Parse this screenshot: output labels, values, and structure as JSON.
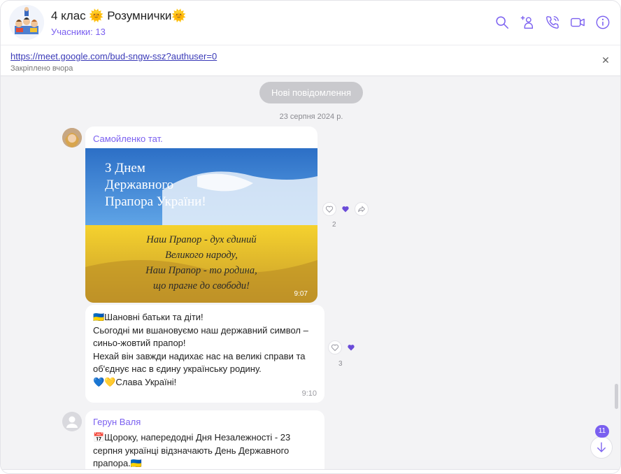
{
  "header": {
    "title": "4 клас 🌞 Розумнички🌞",
    "subtitle": "Учасники: 13",
    "icons": [
      "search-icon",
      "add-participant-icon",
      "voice-call-icon",
      "video-call-icon",
      "info-icon"
    ]
  },
  "pinned": {
    "link": "https://meet.google.com/bud-sngw-ssz?authuser=0",
    "note": "Закріплено вчора",
    "close_icon": "close-icon"
  },
  "chat": {
    "new_messages_label": "Нові повідомлення",
    "date_label": "23 серпня 2024 р.",
    "messages": [
      {
        "sender": "Самойленко тат.",
        "image_text": {
          "title_line1": "З Днем",
          "title_line2": "Державного",
          "title_line3": "Прапора України!",
          "poem_line1": "Наш Прапор - дух єдиний",
          "poem_line2": "Великого народу,",
          "poem_line3": "Наш Прапор - то родина,",
          "poem_line4": "що прагне до свободи!"
        },
        "time": "9:07",
        "reaction_count": "2"
      },
      {
        "text": "🇺🇦Шановні батьки та діти!\nСьогодні ми вшановуємо наш державний символ – синьо-жовтий прапор!\n Нехай він завжди надихає нас на великі справи та об'єднує нас в єдину українську родину.\n💙💛Слава Україні!",
        "time": "9:10",
        "reaction_count": "3"
      },
      {
        "sender": "Герун Валя",
        "text": "📅Щороку, напередодні Дня Незалежності - 23 серпня українці відзначають День Державного прапора.🇺🇦"
      }
    ],
    "unread_count": "11"
  },
  "colors": {
    "accent": "#7a5ff0",
    "bubble": "#ffffff",
    "background": "#f3f3f5"
  }
}
